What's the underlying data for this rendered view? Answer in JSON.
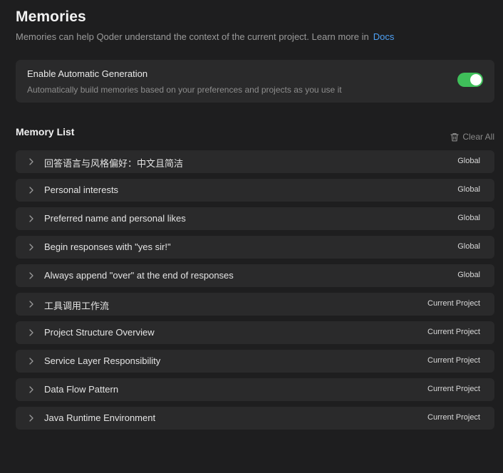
{
  "header": {
    "title": "Memories",
    "subtitle": "Memories can help Qoder understand the context of the current project. Learn more in",
    "docs_link": "Docs"
  },
  "auto_generation": {
    "title": "Enable Automatic Generation",
    "description": "Automatically build memories based on your preferences and projects as you use it",
    "enabled": true
  },
  "memory_list": {
    "heading": "Memory List",
    "clear_all_label": "Clear All",
    "items": [
      {
        "title": "回答语言与风格偏好：中文且简洁",
        "scope": "Global"
      },
      {
        "title": "Personal interests",
        "scope": "Global"
      },
      {
        "title": "Preferred name and personal likes",
        "scope": "Global"
      },
      {
        "title": "Begin responses with \"yes sir!\"",
        "scope": "Global"
      },
      {
        "title": "Always append \"over\" at the end of responses",
        "scope": "Global"
      },
      {
        "title": "工具调用工作流",
        "scope": "Current Project"
      },
      {
        "title": "Project Structure Overview",
        "scope": "Current Project"
      },
      {
        "title": "Service Layer Responsibility",
        "scope": "Current Project"
      },
      {
        "title": "Data Flow Pattern",
        "scope": "Current Project"
      },
      {
        "title": "Java Runtime Environment",
        "scope": "Current Project"
      }
    ]
  },
  "colors": {
    "background": "#1e1e1f",
    "card": "#2a2a2b",
    "link": "#4ea1f5",
    "toggle_on": "#3fbf5a"
  },
  "icons": {
    "row_expand": "chevron-right-icon",
    "clear_all": "trash-icon"
  }
}
